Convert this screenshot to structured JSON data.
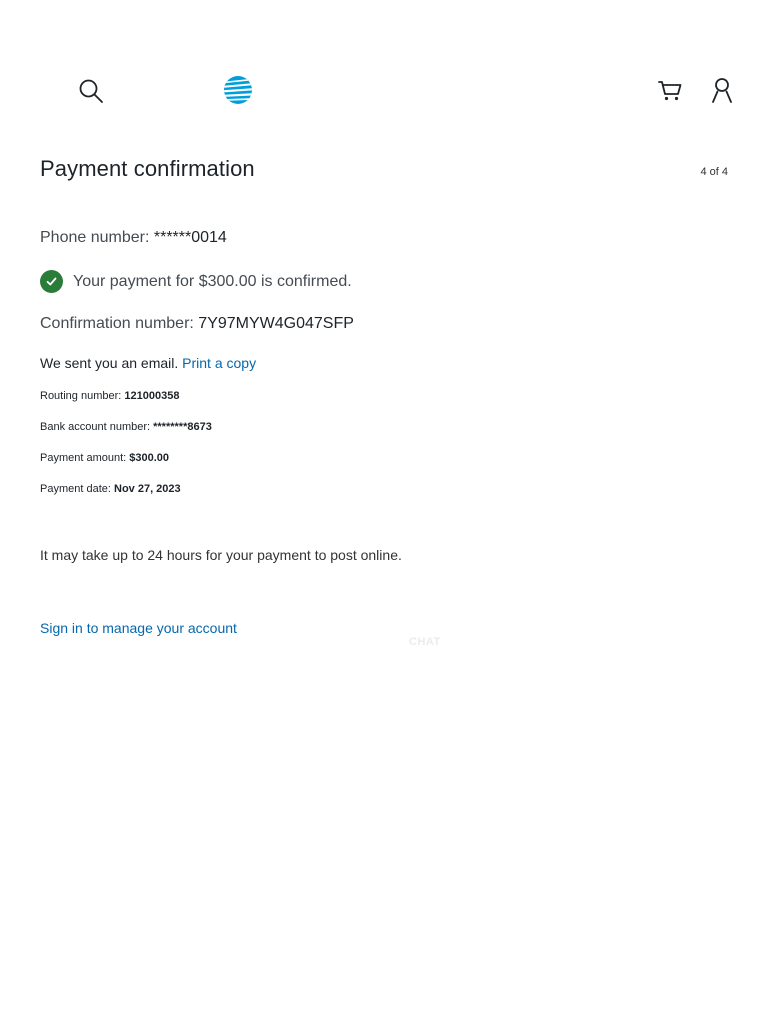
{
  "header": {
    "search_icon": "search-icon",
    "logo_icon": "att-globe-logo",
    "cart_icon": "cart-icon",
    "account_icon": "account-icon",
    "logo_color": "#009fdb"
  },
  "page": {
    "title": "Payment confirmation",
    "step": "4 of 4"
  },
  "payment": {
    "phone_label": "Phone number: ",
    "phone_value": "******0014",
    "confirmed_text": "Your payment for $300.00 is confirmed.",
    "confirmation_label": "Confirmation number: ",
    "confirmation_value": "7Y97MYW4G047SFP",
    "email_text": "We sent you an email. ",
    "print_link": "Print a copy",
    "routing_label": "Routing number: ",
    "routing_value": "121000358",
    "bank_label": "Bank account number: ",
    "bank_value": "********8673",
    "amount_label": "Payment amount: ",
    "amount_value": "$300.00",
    "date_label": "Payment date: ",
    "date_value": "Nov 27, 2023",
    "post_note": "It may take up to 24 hours for your payment to post online.",
    "signin_link": "Sign in to manage your account"
  },
  "chat": {
    "label": "CHAT"
  },
  "colors": {
    "link": "#0568ae",
    "success": "#2a7d39",
    "text": "#1d2329"
  }
}
